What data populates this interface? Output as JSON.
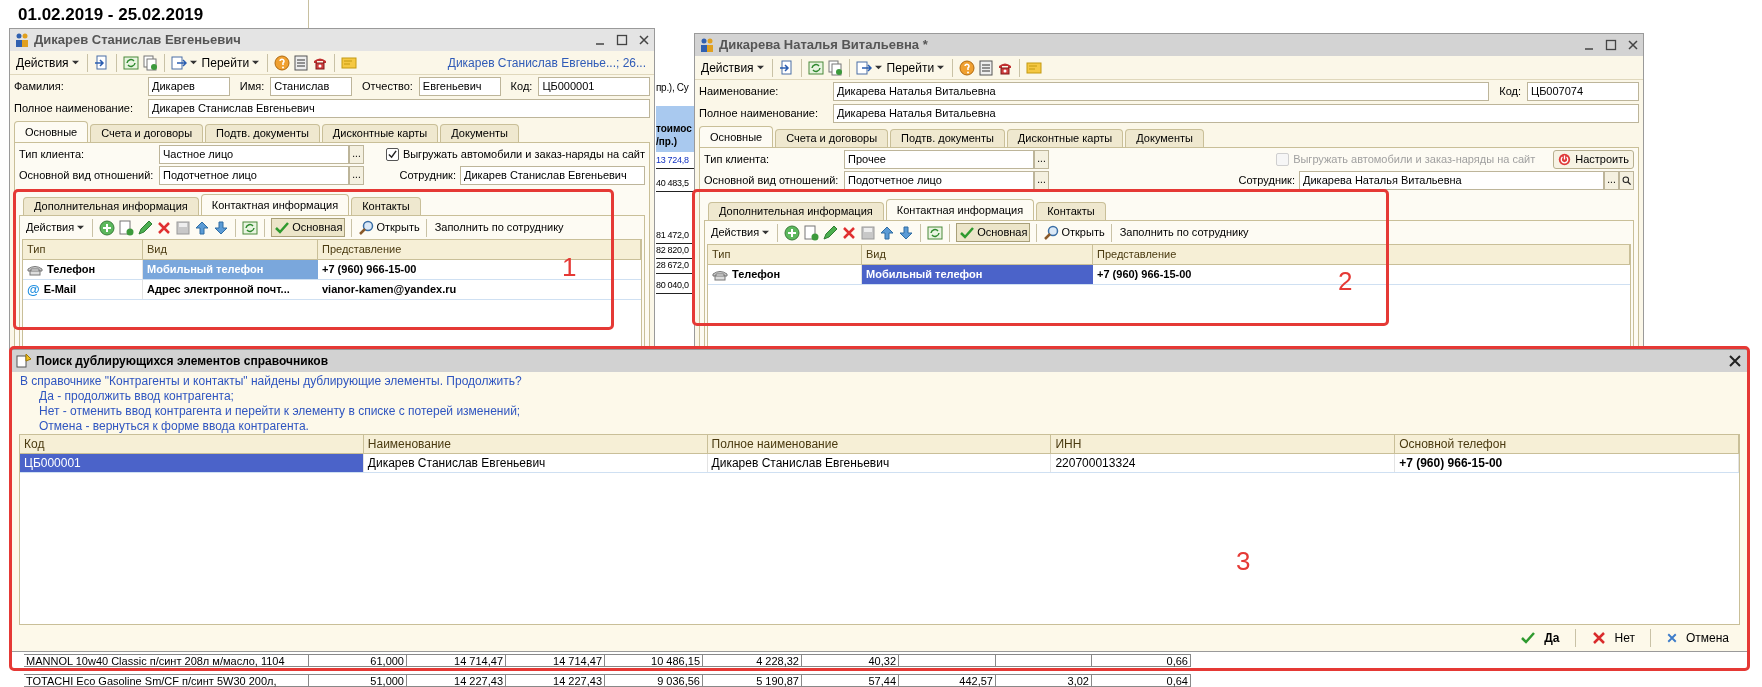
{
  "background": {
    "period": "01.02.2019 - 25.02.2019",
    "fragment": "пр.), Су",
    "column_header": [
      "тоимос",
      "/пр.)"
    ],
    "column_values": [
      {
        "text": "13 724,8",
        "link": true
      },
      {
        "text": "40 483,5",
        "link": false
      },
      {
        "text": "81 472,0",
        "link": false
      },
      {
        "text": "82 820,0",
        "link": false
      },
      {
        "text": "28 672,0",
        "link": false
      },
      {
        "text": "80 040,0",
        "link": false
      }
    ],
    "rows": [
      {
        "name": "MANNOL 10w40 Classic п/синт 208л  м/масло, 1104",
        "column_2": "61,000",
        "column_3": "14 714,47",
        "column_4": "14 714,47",
        "column_5": "10 486,15",
        "column_6": "4 228,32",
        "column_7": "40,32",
        "column_10": "0,66"
      },
      {
        "name": "TOTACHI Eco  Gasoline Sm/CF п/синт 5W30 200л,",
        "column_2": "51,000",
        "column_3": "14 227,43",
        "column_4": "14 227,43",
        "column_5": "9 036,56",
        "column_6": "5 190,87",
        "column_7": "57,44",
        "column_8": "442,57",
        "column_9": "3,02",
        "column_10": "0,64"
      }
    ]
  },
  "windows": [
    {
      "title": "Дикарев Станислав Евгеньевич",
      "active": false,
      "toolbar": {
        "actions": "Действия",
        "goto": "Перейти"
      },
      "link": "Дикарев Станислав Евгенье...; 26...",
      "field_rows": [
        [
          {
            "label": "Фамилия:",
            "value": "Дикарев",
            "kind": "short"
          },
          {
            "label": "Имя:",
            "value": "Станислав",
            "kind": "short"
          },
          {
            "label": "Отчество:",
            "value": "Евгеньевич",
            "kind": "short"
          },
          {
            "label": "Код:",
            "value": "ЦБ000001",
            "kind": "code"
          }
        ],
        [
          {
            "label": "Полное наименование:",
            "value": "Дикарев Станислав Евгеньевич",
            "kind": "wide"
          }
        ]
      ],
      "tabs": [
        {
          "label": "Основные",
          "selected": true
        },
        {
          "label": "Счета и договоры",
          "selected": false
        },
        {
          "label": "Подтв. документы",
          "selected": false
        },
        {
          "label": "Дисконтные карты",
          "selected": false
        },
        {
          "label": "Документы",
          "selected": false
        }
      ],
      "client_type": {
        "label": "Тип клиента:",
        "value": "Частное лицо",
        "more": "..."
      },
      "upload": {
        "label": "Выгружать автомобили и заказ-наряды на сайт",
        "checked": true,
        "disabled": false
      },
      "relation": {
        "label": "Основной вид отношений:",
        "value": "Подотчетное лицо",
        "more": "..."
      },
      "employee": {
        "label": "Сотрудник:",
        "value": "Дикарев Станислав Евгеньевич"
      },
      "inner_tabs": [
        {
          "label": "Дополнительная информация",
          "selected": false
        },
        {
          "label": "Контактная информация",
          "selected": true
        },
        {
          "label": "Контакты",
          "selected": false
        }
      ],
      "contact_toolbar": {
        "actions": "Действия",
        "main": "Основная",
        "main_pressed": true,
        "open": "Открыть",
        "fill": "Заполнить по сотруднику"
      },
      "contacts": {
        "columns": [
          "Тип",
          "Вид",
          "Представление"
        ],
        "rows": [
          {
            "kind": "phone",
            "type": "Телефон",
            "view": "Мобильный телефон",
            "value": "+7 (960) 966-15-00",
            "selected": true
          },
          {
            "kind": "email",
            "marker": "@",
            "type": "E-Mail",
            "view": "Адрес электронной почт...",
            "value": "vianor-kamen@yandex.ru",
            "selected": false
          }
        ]
      }
    },
    {
      "title": "Дикарева Наталья Витальевна *",
      "active": true,
      "toolbar": {
        "actions": "Действия",
        "goto": "Перейти"
      },
      "field_rows": [
        [
          {
            "label": "Наименование:",
            "value": "Дикарева Наталья Витальевна",
            "kind": "wide"
          },
          {
            "label": "Код:",
            "value": "ЦБ007074",
            "kind": "code"
          }
        ],
        [
          {
            "label": "Полное наименование:",
            "value": "Дикарева Наталья Витальевна",
            "kind": "wide"
          }
        ]
      ],
      "tabs": [
        {
          "label": "Основные",
          "selected": true
        },
        {
          "label": "Счета и договоры",
          "selected": false
        },
        {
          "label": "Подтв. документы",
          "selected": false
        },
        {
          "label": "Дисконтные карты",
          "selected": false
        },
        {
          "label": "Документы",
          "selected": false
        }
      ],
      "client_type": {
        "label": "Тип клиента:",
        "value": "Прочее",
        "more": "..."
      },
      "upload": {
        "label": "Выгружать автомобили и заказ-наряды на сайт",
        "checked": false,
        "disabled": true
      },
      "setup_button": "Настроить",
      "relation": {
        "label": "Основной вид отношений:",
        "value": "Подотчетное лицо",
        "more": "..."
      },
      "employee": {
        "label": "Сотрудник:",
        "value": "Дикарева Наталья Витальевна",
        "more": "..."
      },
      "inner_tabs": [
        {
          "label": "Дополнительная информация",
          "selected": false
        },
        {
          "label": "Контактная информация",
          "selected": true
        },
        {
          "label": "Контакты",
          "selected": false
        }
      ],
      "contact_toolbar": {
        "actions": "Действия",
        "main": "Основная",
        "main_pressed": true,
        "open": "Открыть",
        "fill": "Заполнить по сотруднику"
      },
      "contacts": {
        "columns": [
          "Тип",
          "Вид",
          "Представление"
        ],
        "rows": [
          {
            "kind": "phone",
            "type": "Телефон",
            "view": "Мобильный телефон",
            "value": "+7 (960) 966-15-00",
            "selected": true
          }
        ]
      }
    }
  ],
  "dialog": {
    "title": "Поиск дублирующихся элементов справочников",
    "message": [
      {
        "kind": "intro",
        "text": "В справочнике \"Контрагенты и контакты\" найдены дублирующие элементы. Продолжить?"
      },
      {
        "kind": "option",
        "text": "Да - продолжить ввод контрагента;"
      },
      {
        "kind": "option",
        "text": "Нет - отменить ввод контрагента и перейти к элементу в списке с потерей изменений;"
      },
      {
        "kind": "option",
        "text": "Отмена - вернуться к форме ввода контрагента."
      }
    ],
    "columns": [
      "Код",
      "Наименование",
      "Полное наименование",
      "ИНН",
      "Основной телефон"
    ],
    "rows": [
      {
        "cells": [
          "ЦБ000001",
          "Дикарев Станислав Евгеньевич",
          "Дикарев Станислав Евгеньевич",
          "220700013324",
          "+7 (960) 966-15-00"
        ],
        "selected": true
      }
    ],
    "buttons": [
      {
        "kind": "yes",
        "label": "Да"
      },
      {
        "kind": "no",
        "label": "Нет"
      },
      {
        "kind": "cancel",
        "label": "Отмена"
      }
    ]
  },
  "annotations": [
    {
      "label": "1"
    },
    {
      "label": "2"
    },
    {
      "label": "3"
    }
  ]
}
